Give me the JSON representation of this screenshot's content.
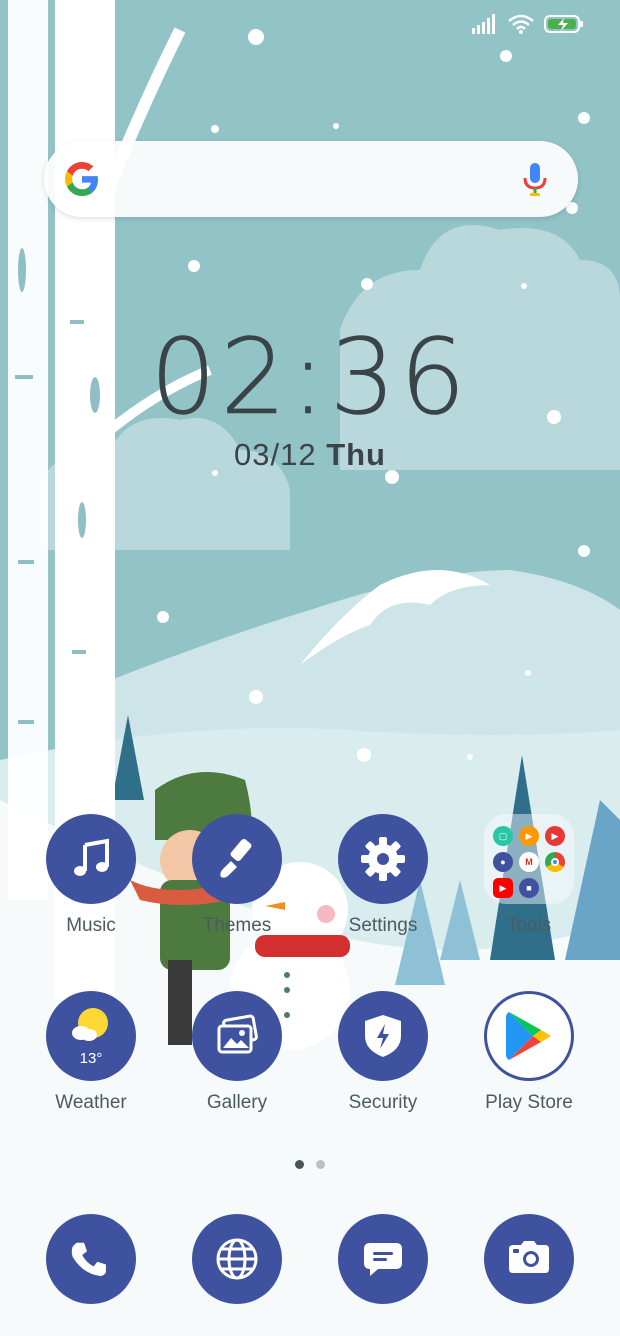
{
  "status_bar": {
    "icons": [
      "signal-icon",
      "wifi-icon",
      "battery-charging-icon"
    ]
  },
  "search_widget": {
    "logo": "google-g-icon",
    "mic": "mic-icon"
  },
  "clock": {
    "time": "02:36",
    "date": "03/12",
    "day": "Thu"
  },
  "home_apps": [
    {
      "label": "Music",
      "icon": "music-note-icon"
    },
    {
      "label": "Themes",
      "icon": "paintbrush-icon"
    },
    {
      "label": "Settings",
      "icon": "gear-icon"
    },
    {
      "label": "Tools",
      "icon": "folder-icon"
    },
    {
      "label": "Weather",
      "icon": "weather-sun-cloud-icon",
      "badge": "13°"
    },
    {
      "label": "Gallery",
      "icon": "photos-icon"
    },
    {
      "label": "Security",
      "icon": "shield-bolt-icon"
    },
    {
      "label": "Play Store",
      "icon": "play-store-icon"
    }
  ],
  "page_indicator": {
    "count": 2,
    "active": 1
  },
  "dock": [
    {
      "icon": "phone-icon"
    },
    {
      "icon": "browser-globe-icon"
    },
    {
      "icon": "messages-icon"
    },
    {
      "icon": "camera-icon"
    }
  ],
  "colors": {
    "app_circle": "#3f52a0",
    "sky": "#92c3c7",
    "snow": "#ffffff"
  }
}
